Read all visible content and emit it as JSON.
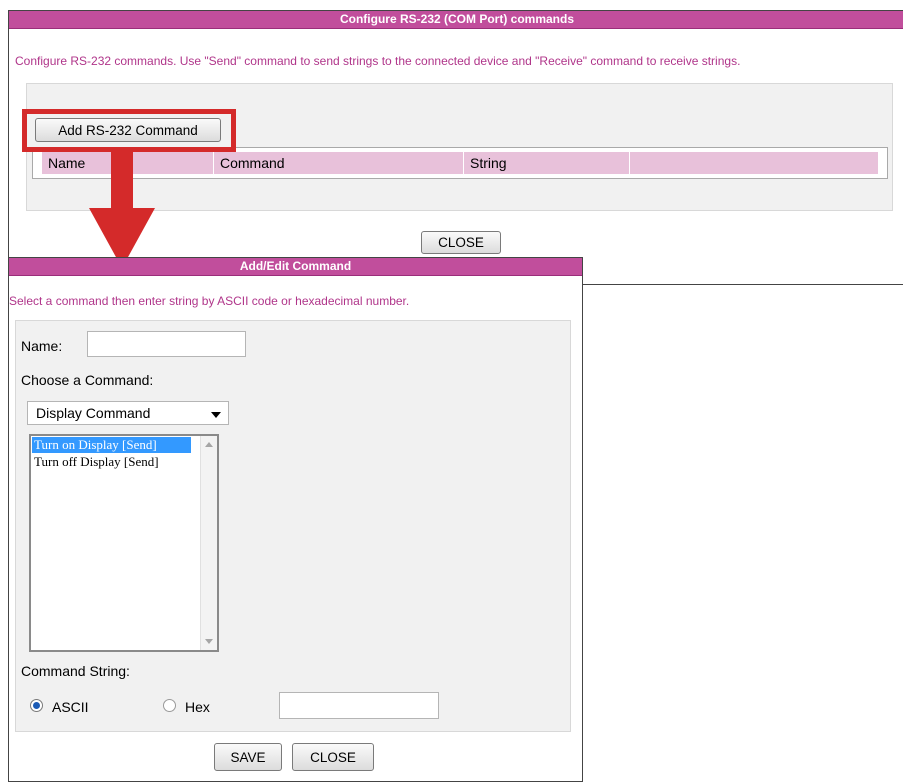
{
  "config_window": {
    "title": "Configure RS-232 (COM Port) commands",
    "description": "Configure RS-232 commands. Use \"Send\" command to send strings to the connected device and \"Receive\" command to receive strings.",
    "add_button": "Add RS-232 Command",
    "table_headers": [
      "Name",
      "Command",
      "String",
      ""
    ],
    "close_button": "CLOSE"
  },
  "edit_window": {
    "title": "Add/Edit Command",
    "description": "Select a command then enter string by ASCII code or hexadecimal number.",
    "name_label": "Name:",
    "name_value": "",
    "choose_label": "Choose a Command:",
    "selected_command": "Display Command",
    "commands": [
      {
        "label": "Turn on Display [Send]",
        "selected": true
      },
      {
        "label": "Turn off Display [Send]",
        "selected": false
      }
    ],
    "command_string_label": "Command String:",
    "radio_ascii": "ASCII",
    "radio_hex": "Hex",
    "selected_format": "ASCII",
    "string_value": "",
    "save_button": "SAVE",
    "close_button": "CLOSE"
  },
  "colors": {
    "title_bar": "#c14e9c",
    "description_text": "#b0358a",
    "table_header": "#e8c1da",
    "highlight_annotation": "#d42a2a",
    "selected_item": "#3399ff"
  }
}
